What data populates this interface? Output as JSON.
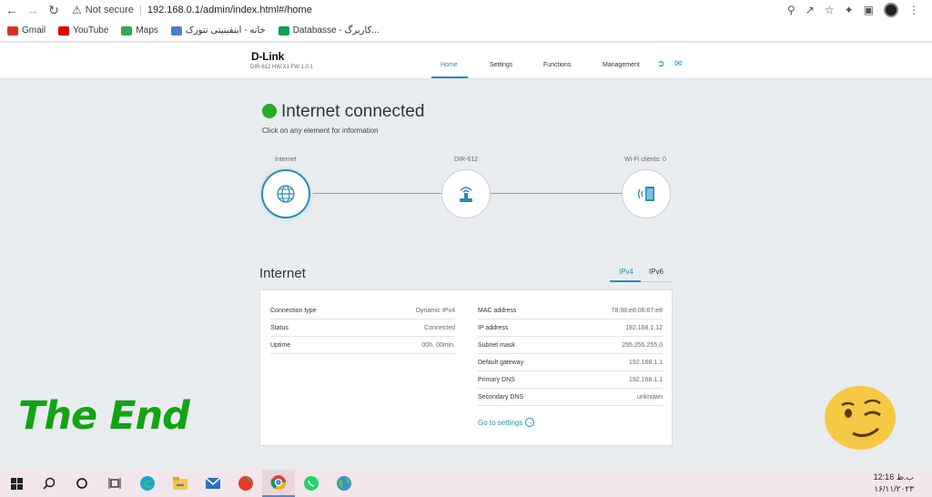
{
  "browser": {
    "security_label": "Not secure",
    "url": "192.168.0.1/admin/index.html#/home"
  },
  "bookmarks": [
    {
      "label": "Gmail",
      "color": "#d93025"
    },
    {
      "label": "YouTube",
      "color": "#e00000"
    },
    {
      "label": "Maps",
      "color": "#34a853"
    },
    {
      "label": "خانه - اینفینیتی نتورک",
      "color": "#4a7fc1"
    },
    {
      "label": "Databasse - کاربرگ...",
      "color": "#0f9d58"
    }
  ],
  "router": {
    "brand": "D-Link",
    "model_info": "DIR-612 HW:X1 FW:1.0.1",
    "nav": [
      "Home",
      "Settings",
      "Functions",
      "Management"
    ]
  },
  "status": {
    "title": "Internet connected",
    "subtitle": "Click on any element for information"
  },
  "topology": {
    "internet_label": "Internet",
    "router_label": "DIR-612",
    "wifi_label": "Wi-Fi clients:",
    "wifi_count": "0"
  },
  "internet_panel": {
    "title": "Internet",
    "tabs": [
      "IPv4",
      "IPv6"
    ],
    "left": [
      {
        "key": "Connection type",
        "value": "Dynamic IPv4"
      },
      {
        "key": "Status",
        "value": "Connected"
      },
      {
        "key": "Uptime",
        "value": "00h. 00min."
      }
    ],
    "right": [
      {
        "key": "MAC address",
        "value": "78:98:e8:06:67:e8"
      },
      {
        "key": "IP address",
        "value": "192.168.1.12"
      },
      {
        "key": "Subnet mask",
        "value": "255.255.255.0"
      },
      {
        "key": "Default gateway",
        "value": "192.168.1.1"
      },
      {
        "key": "Primary DNS",
        "value": "192.168.1.1"
      },
      {
        "key": "Secondary DNS",
        "value": "unknown"
      }
    ],
    "goto_label": "Go to settings"
  },
  "overlay": {
    "text": "The End"
  },
  "taskbar": {
    "time": "12:16 ب.ظ",
    "date": "۱۶/۱۱/۲۰۲۳"
  }
}
